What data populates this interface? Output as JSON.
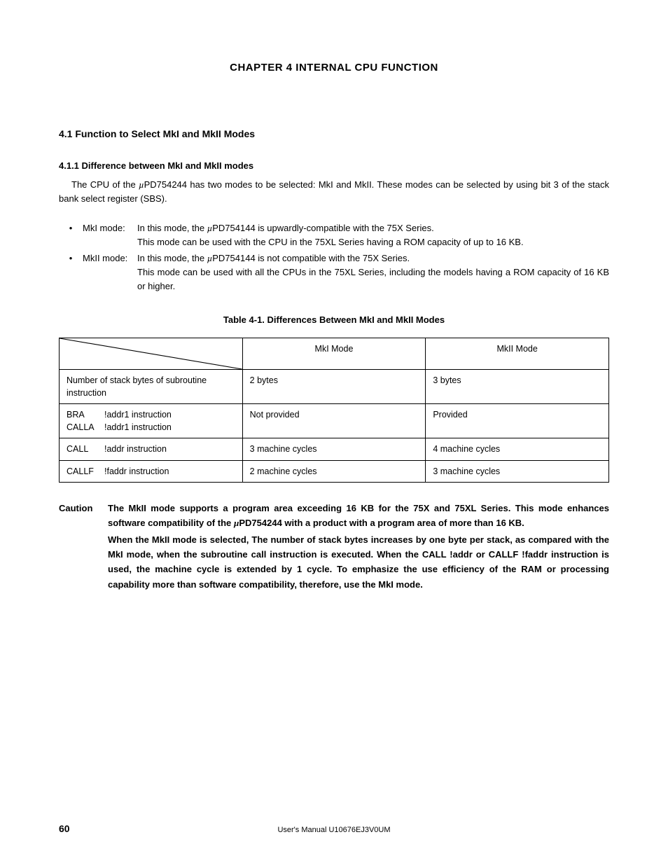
{
  "chapter_title": "CHAPTER 4   INTERNAL CPU FUNCTION",
  "section_4_1": "4.1  Function to Select MkI and MkII Modes",
  "sub_4_1_1": "4.1.1  Difference between MkI and MkII modes",
  "intro_a": "The CPU of the ",
  "intro_b": "PD754244 has two modes to be selected: MkI and MkII.  These modes can be selected by using bit 3 of the stack bank select register (SBS).",
  "mk1_label": "MkI mode:",
  "mk1_line1a": "In this mode, the ",
  "mk1_line1b": "PD754144 is upwardly-compatible with the 75X Series.",
  "mk1_line2": "This mode can be used with the CPU in the 75XL Series having a ROM capacity of up to 16 KB.",
  "mk2_label": "MkII mode:",
  "mk2_line1a": "In this mode, the ",
  "mk2_line1b": "PD754144 is not compatible with the 75X Series.",
  "mk2_line2": "This mode can be used with all the CPUs in the 75XL Series, including the models having a ROM capacity of 16 KB or higher.",
  "table_title": "Table 4-1.  Differences Between MkI and MkII Modes",
  "table": {
    "col1": "MkI Mode",
    "col2": "MkII Mode",
    "rows": [
      {
        "label": "Number of stack bytes of subroutine instruction",
        "c1": "2 bytes",
        "c2": "3 bytes"
      },
      {
        "label_a": "BRA",
        "label_b": "!addr1 instruction",
        "label_c": "CALLA",
        "label_d": "!addr1 instruction",
        "c1": "Not provided",
        "c2": "Provided"
      },
      {
        "label_a": "CALL",
        "label_b": "!addr instruction",
        "c1": "3 machine cycles",
        "c2": "4 machine cycles"
      },
      {
        "label_a": "CALLF",
        "label_b": "!faddr instruction",
        "c1": "2 machine cycles",
        "c2": "3 machine cycles"
      }
    ]
  },
  "caution_label": "Caution",
  "caution_p1a": "The MkII mode supports a program area exceeding 16 KB for the 75X and 75XL Series.  This mode enhances software compatibility of the ",
  "caution_p1b": "PD754244 with a product with a program area of more than 16 KB.",
  "caution_p2": "When the MkII mode is selected, The number of stack bytes increases by one byte per stack, as compared with the MkI mode, when the subroutine call instruction is executed.  When the CALL !addr or CALLF !faddr instruction is used, the machine cycle is extended by 1 cycle.  To emphasize the use efficiency of the RAM or processing capability more than software compatibility, therefore, use the MkI mode.",
  "page_number": "60",
  "footer_text": "User's Manual  U10676EJ3V0UM"
}
